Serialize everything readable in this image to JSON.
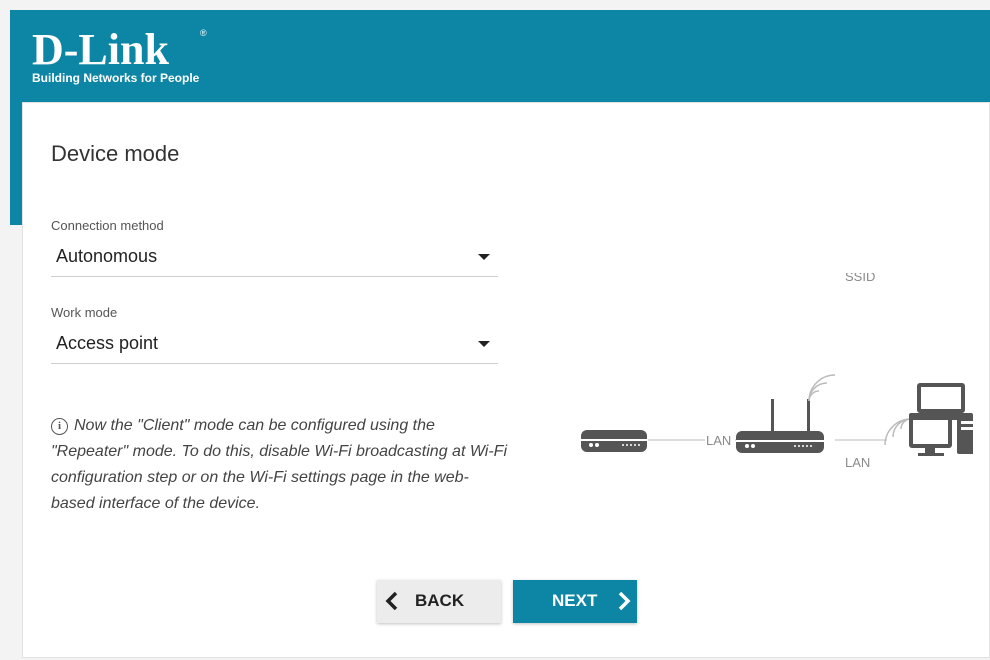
{
  "brand": {
    "logo_text": "D-Link",
    "registered": "®",
    "tagline": "Building Networks for People"
  },
  "page": {
    "title": "Device mode"
  },
  "connection_method": {
    "label": "Connection method",
    "value": "Autonomous"
  },
  "work_mode": {
    "label": "Work mode",
    "value": "Access point"
  },
  "info_icon_glyph": "i",
  "note": "Now the \"Client\" mode can be configured using the \"Repeater\" mode. To do this, disable Wi-Fi broadcasting at Wi-Fi configuration step or on the Wi-Fi settings page in the web-based interface of the device.",
  "diagram": {
    "ssid_label": "SSID",
    "lan_label_left": "LAN",
    "lan_label_right": "LAN",
    "devices": [
      "modem-icon",
      "router-icon",
      "laptop-icon",
      "desktop-computer-icon"
    ]
  },
  "buttons": {
    "back": "BACK",
    "next": "NEXT"
  },
  "colors": {
    "brand_blue": "#0d86a6",
    "device_gray": "#555555",
    "line_gray": "#bbbbbb"
  }
}
